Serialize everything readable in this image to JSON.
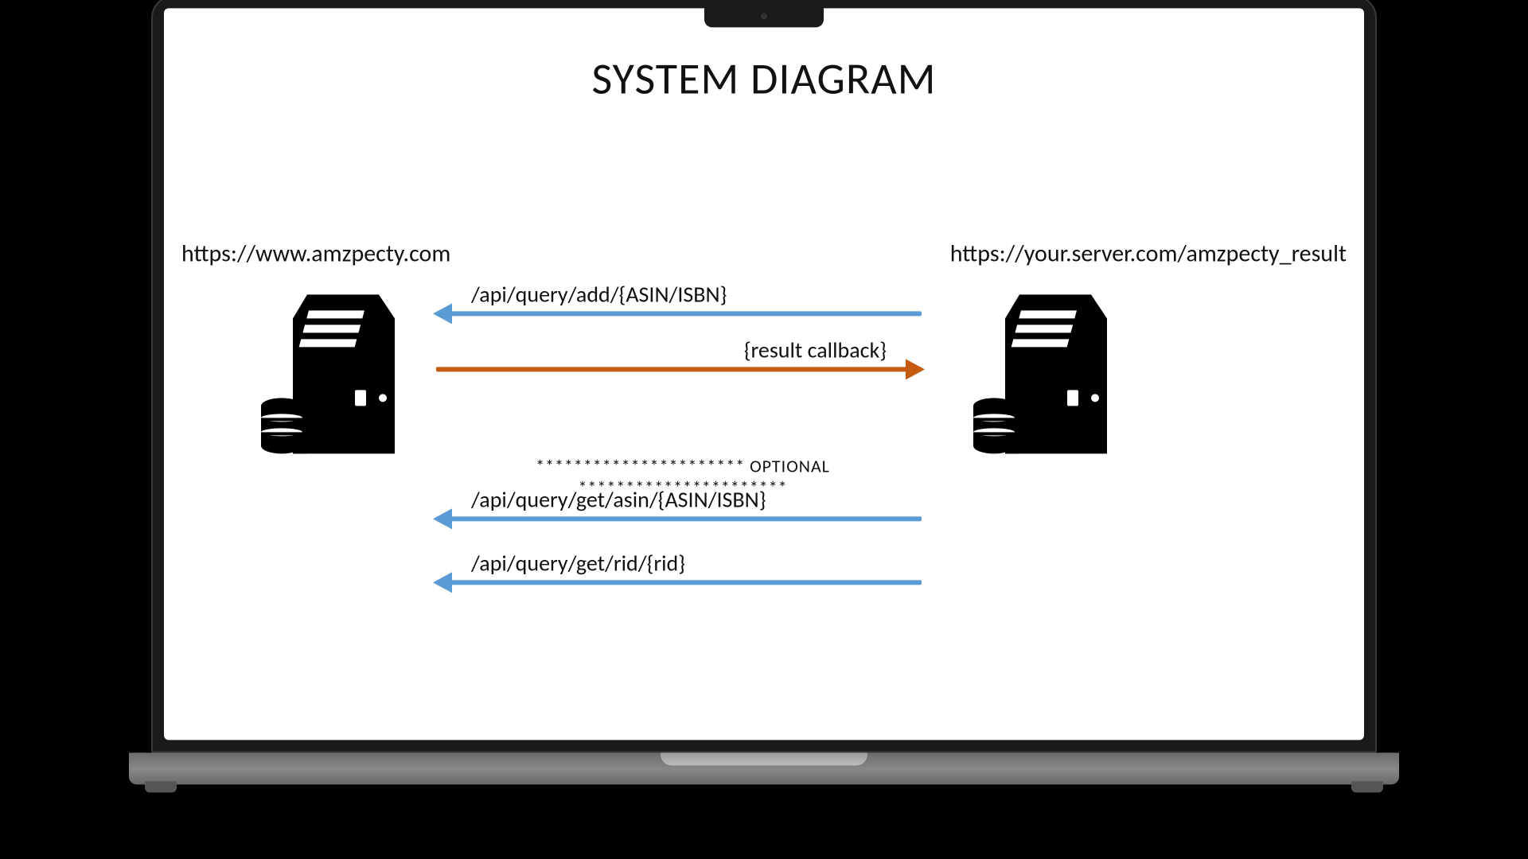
{
  "title": "SYSTEM DIAGRAM",
  "left_url": "https://www.amzpecty.com",
  "right_url": "https://your.server.com/amzpecty_result",
  "arrows": {
    "add": "/api/query/add/{ASIN/ISBN}",
    "callback": "{result callback}",
    "get_asin": "/api/query/get/asin/{ASIN/ISBN}",
    "get_rid": "/api/query/get/rid/{rid}"
  },
  "divider": "********************** OPTIONAL **********************"
}
